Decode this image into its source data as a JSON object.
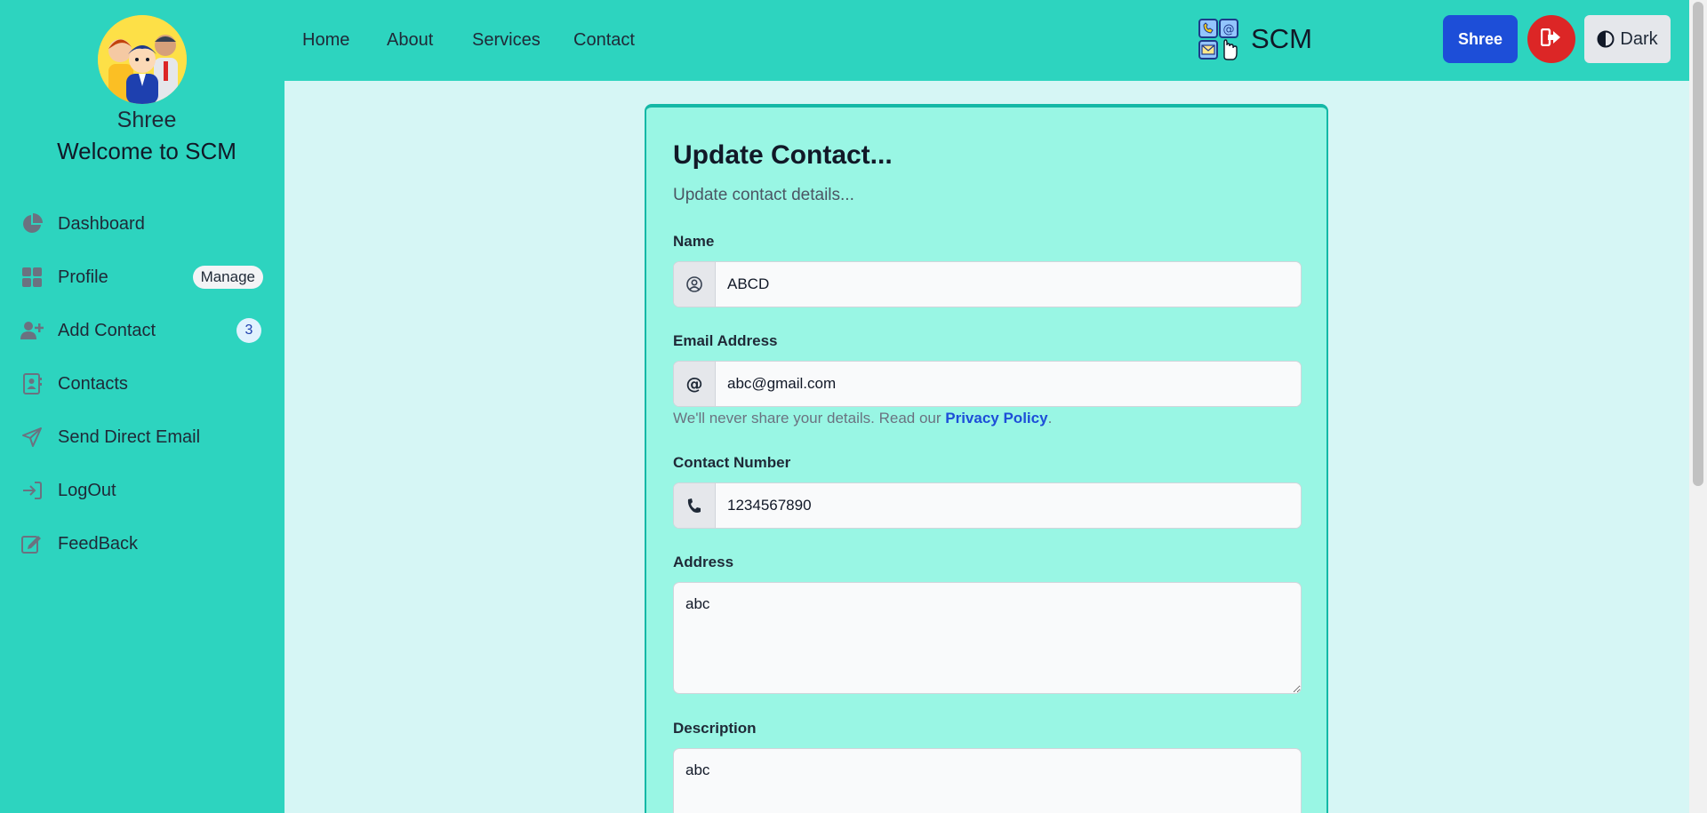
{
  "sidebar": {
    "user_name": "Shree",
    "welcome": "Welcome to SCM",
    "items": [
      {
        "label": "Dashboard",
        "icon": "pie-chart-icon"
      },
      {
        "label": "Profile",
        "icon": "grid-icon",
        "badge": "Manage"
      },
      {
        "label": "Add Contact",
        "icon": "user-plus-icon",
        "count": "3"
      },
      {
        "label": "Contacts",
        "icon": "address-book-icon"
      },
      {
        "label": "Send Direct Email",
        "icon": "paper-plane-icon"
      },
      {
        "label": "LogOut",
        "icon": "logout-icon"
      },
      {
        "label": "FeedBack",
        "icon": "edit-icon"
      }
    ]
  },
  "topnav": {
    "links": [
      "Home",
      "About",
      "Services",
      "Contact"
    ],
    "brand": "SCM",
    "user_button": "Shree",
    "theme_button": "Dark"
  },
  "form": {
    "title": "Update Contact...",
    "subtitle": "Update contact details...",
    "name": {
      "label": "Name",
      "value": "ABCD"
    },
    "email": {
      "label": "Email Address",
      "value": "abc@gmail.com"
    },
    "help": {
      "text": "We'll never share your details. Read our ",
      "link": "Privacy Policy",
      "end": "."
    },
    "phone": {
      "label": "Contact Number",
      "value": "1234567890"
    },
    "address": {
      "label": "Address",
      "value": "abc"
    },
    "description": {
      "label": "Description",
      "value": "abc"
    }
  },
  "colors": {
    "accent": "#2dd4bf",
    "card": "#99f6e4",
    "primary_button": "#1d4ed8",
    "logout_button": "#dc2626",
    "background": "#d6f6f5"
  }
}
